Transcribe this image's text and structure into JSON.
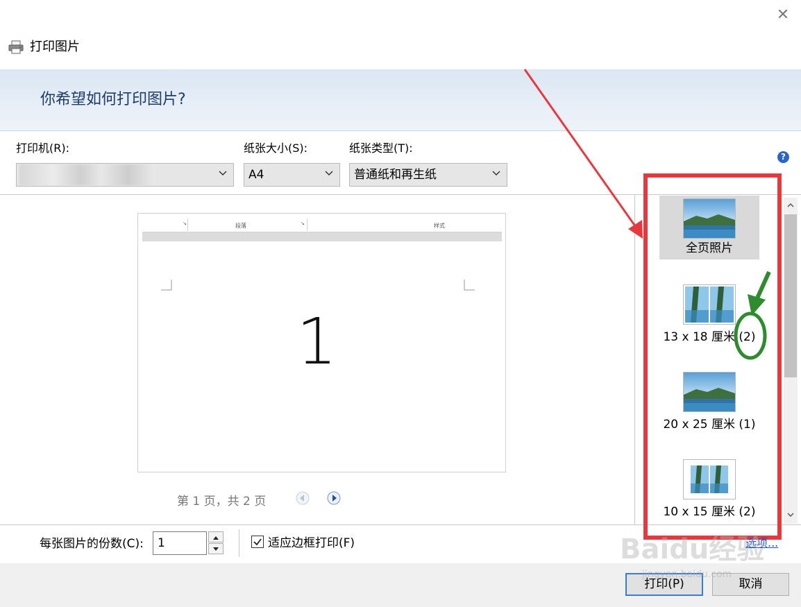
{
  "window": {
    "title": "打印图片",
    "close_glyph": "✕"
  },
  "header": {
    "question": "你希望如何打印图片?"
  },
  "settings": {
    "printer_label": "打印机(R):",
    "paper_size_label": "纸张大小(S):",
    "paper_size_value": "A4",
    "paper_type_label": "纸张类型(T):",
    "paper_type_value": "普通纸和再生纸",
    "help_glyph": "?"
  },
  "preview": {
    "ribbon_labels": [
      "段落",
      "样式"
    ],
    "page_number": "1",
    "page_indicator": "第 1 页，共 2 页"
  },
  "layouts": [
    {
      "label": "全页照片",
      "selected": true
    },
    {
      "label": "13 x 18 厘米 (2)",
      "selected": false
    },
    {
      "label": "20 x 25 厘米 (1)",
      "selected": false
    },
    {
      "label": "10 x 15 厘米 (2)",
      "selected": false
    }
  ],
  "bottom": {
    "copies_label": "每张图片的份数(C):",
    "copies_value": "1",
    "fit_label": "适应边框打印(F)",
    "fit_checked": true,
    "options_label": "选项..."
  },
  "buttons": {
    "print": "打印(P)",
    "cancel": "取消"
  },
  "annotation": {
    "highlight_color": "#e8383d",
    "circle_color": "#2e8b2e",
    "arrow_color": "#2e8b2e"
  },
  "watermark": {
    "text": "Baidu经验",
    "sub": "jingyan.baidu.com"
  }
}
